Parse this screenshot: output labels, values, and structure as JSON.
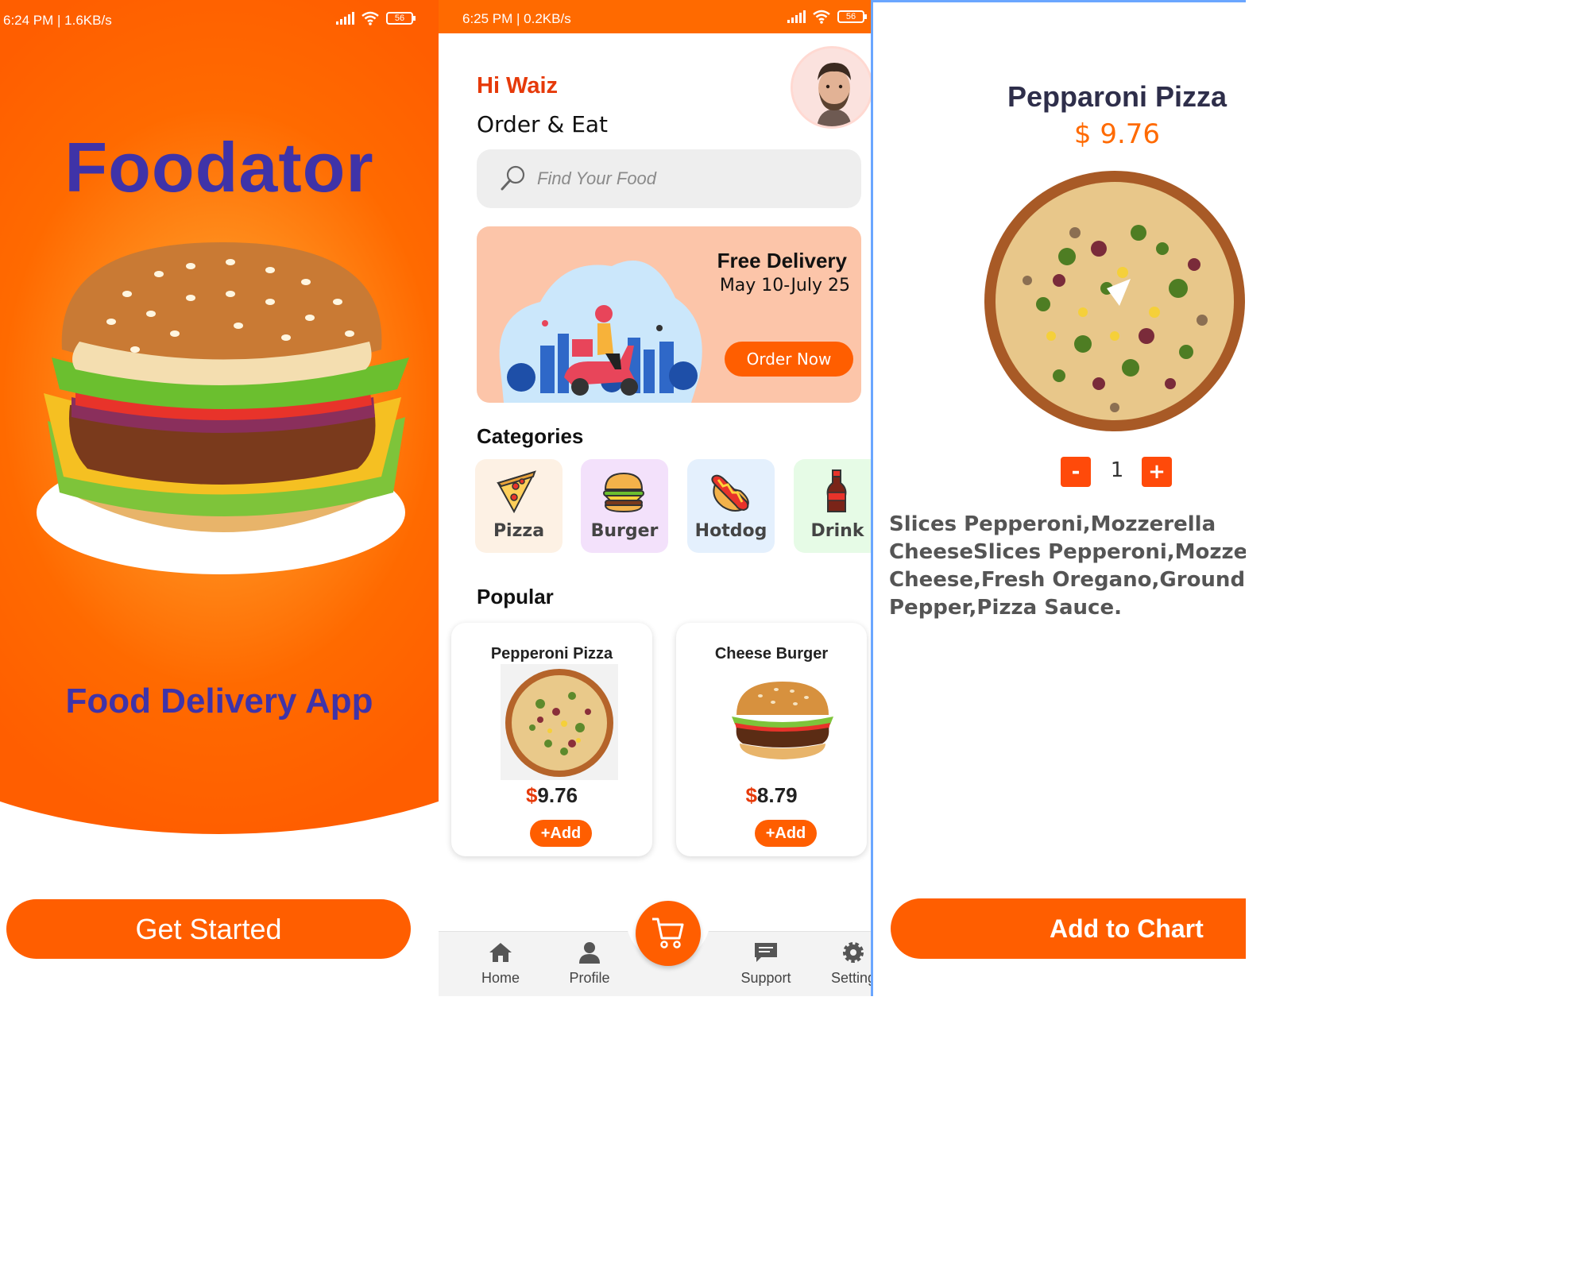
{
  "splash": {
    "status_time": "6:24 PM | 1.6KB/s",
    "battery": "56",
    "brand": "Foodator",
    "tagline": "Food Delivery App",
    "get_started_label": "Get Started"
  },
  "home": {
    "status_time": "6:25 PM | 0.2KB/s",
    "battery": "56",
    "greeting": "Hi Waiz",
    "subgreeting": "Order & Eat",
    "search_placeholder": "Find Your Food",
    "promo": {
      "title": "Free Delivery",
      "dates": "May 10-July 25",
      "button_label": "Order Now"
    },
    "categories_title": "Categories",
    "categories": [
      {
        "label": "Pizza",
        "icon": "pizza-slice-icon",
        "bg": "#fdf1e4"
      },
      {
        "label": "Burger",
        "icon": "burger-icon",
        "bg": "#f3e1fb"
      },
      {
        "label": "Hotdog",
        "icon": "hotdog-icon",
        "bg": "#e4f0fd"
      },
      {
        "label": "Drink",
        "icon": "soda-bottle-icon",
        "bg": "#e6fbe6"
      }
    ],
    "popular_title": "Popular",
    "popular": [
      {
        "name": "Pepperoni Pizza",
        "currency": "$",
        "price": "9.76",
        "add_label": "+Add"
      },
      {
        "name": "Cheese Burger",
        "currency": "$",
        "price": "8.79",
        "add_label": "+Add"
      }
    ],
    "nav": [
      {
        "label": "Home",
        "icon": "home-icon"
      },
      {
        "label": "Profile",
        "icon": "person-icon"
      },
      {
        "label": "Support",
        "icon": "chat-icon"
      },
      {
        "label": "Setting",
        "icon": "gear-icon"
      }
    ],
    "cart_icon": "cart-icon"
  },
  "detail": {
    "title": "Pepparoni Pizza",
    "price": "$ 9.76",
    "qty_minus": "-",
    "qty": "1",
    "qty_plus": "+",
    "description_lines": [
      "Slices Pepperoni,Mozzerella",
      "CheeseSlices Pepperoni,Mozzerella",
      "Cheese,Fresh Oregano,Ground Black",
      "Pepper,Pizza Sauce."
    ],
    "add_button_label": "Add to Chart"
  },
  "colors": {
    "accent": "#ff5e00",
    "brand_text": "#3f33a8",
    "greeting_red": "#e63a0a"
  }
}
